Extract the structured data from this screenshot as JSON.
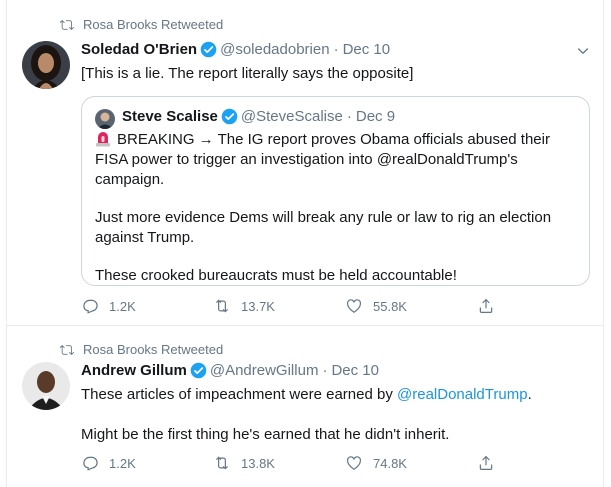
{
  "tweets": [
    {
      "retweeted_by": "Rosa Brooks Retweeted",
      "name": "Soledad O'Brien",
      "handle": "@soledadobrien",
      "dot": "·",
      "date": "Dec 10",
      "text": "[This is a lie. The report literally says the opposite]",
      "quote": {
        "name": "Steve Scalise",
        "handle": "@SteveScalise",
        "dot": "·",
        "date": "Dec 9",
        "paragraphs": [
          "BREAKING → The IG report proves Obama officials abused their FISA power to trigger an investigation into @realDonaldTrump's campaign.",
          "Just more evidence Dems will break any rule or law to rig an election against Trump.",
          "These crooked bureaucrats must be held accountable!"
        ]
      },
      "actions": {
        "replies": "1.2K",
        "retweets": "13.7K",
        "likes": "55.8K"
      }
    },
    {
      "retweeted_by": "Rosa Brooks Retweeted",
      "name": "Andrew Gillum",
      "handle": "@AndrewGillum",
      "dot": "·",
      "date": "Dec 10",
      "text_before_link": "These articles of impeachment were earned by ",
      "link": "@realDonaldTrump",
      "text_after_link": ".",
      "text_2": "Might be the first thing he's earned that he didn't inherit.",
      "actions": {
        "replies": "1.2K",
        "retweets": "13.8K",
        "likes": "74.8K"
      }
    }
  ],
  "colors": {
    "accent": "#1da1f2",
    "link": "#1b95e0",
    "muted": "#657786",
    "siren": "#e0245e"
  },
  "icons": [
    "retweet-icon",
    "verified-badge-icon",
    "chevron-down-icon",
    "reply-icon",
    "like-icon",
    "share-icon",
    "siren-emoji-icon"
  ]
}
